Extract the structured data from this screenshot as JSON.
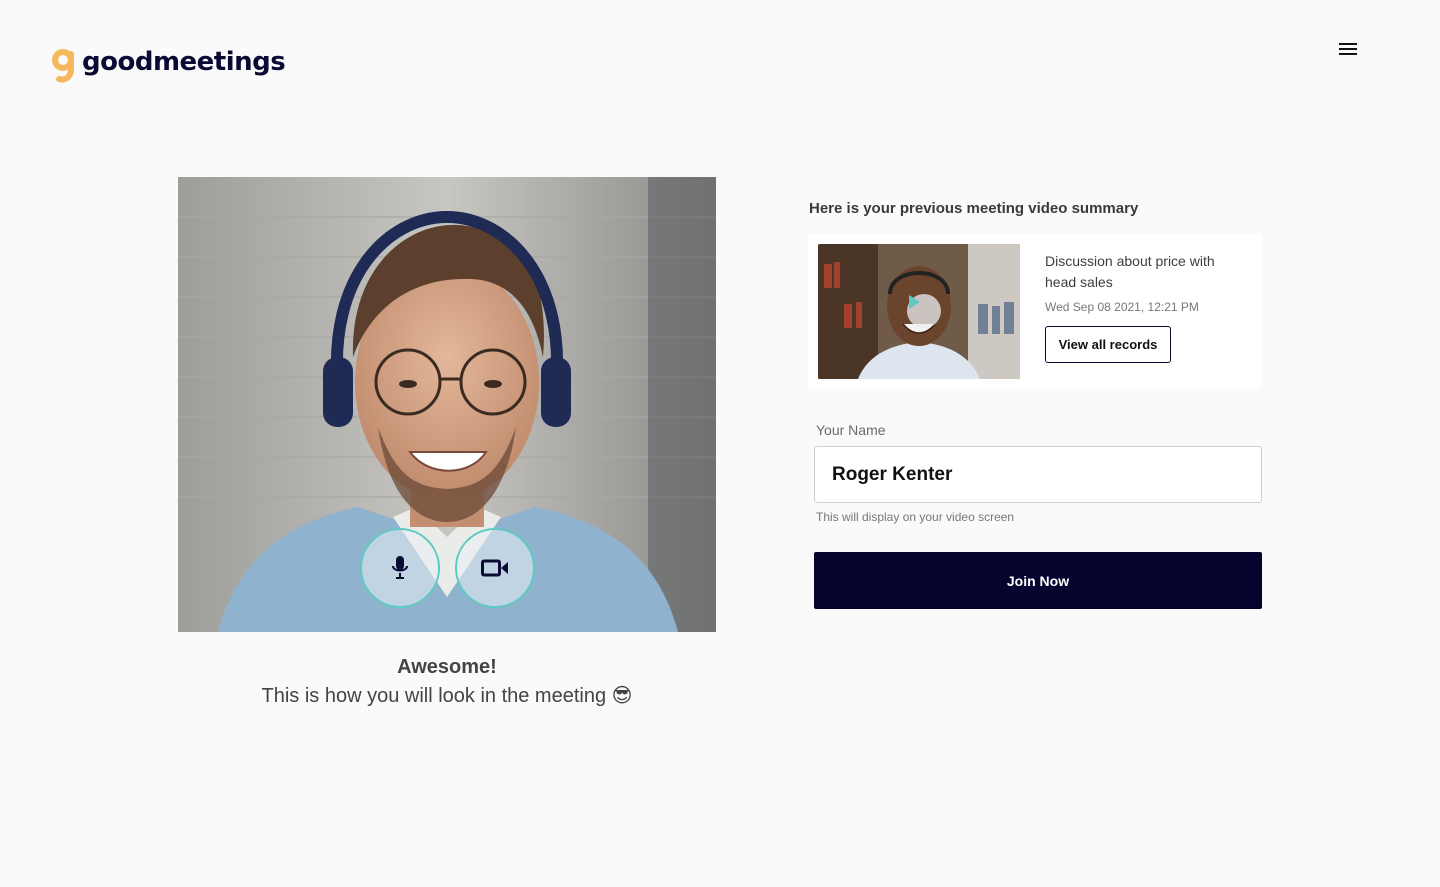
{
  "brand": {
    "name": "goodmeetings",
    "mark_letter": "g",
    "mark_color": "#f6b85a",
    "text_color": "#0b0a35"
  },
  "header": {
    "menu_icon": "hamburger-menu-icon"
  },
  "preview": {
    "mic_icon": "microphone-icon",
    "camera_icon": "video-camera-icon",
    "caption_title": "Awesome!",
    "caption_text": "This is how you will look in the meeting",
    "caption_emoji": "😎"
  },
  "summary": {
    "heading": "Here is your previous meeting video summary",
    "record": {
      "title": "Discussion about price with head sales",
      "date": "Wed Sep 08 2021, 12:21 PM",
      "play_icon": "play-icon",
      "button_label": "View all records"
    }
  },
  "form": {
    "name_label": "Your Name",
    "name_value": "Roger Kenter",
    "name_hint": "This will display on your video screen",
    "join_label": "Join Now"
  },
  "colors": {
    "primary": "#05042f",
    "accent": "#5ecbc0",
    "background": "#fafafa"
  }
}
